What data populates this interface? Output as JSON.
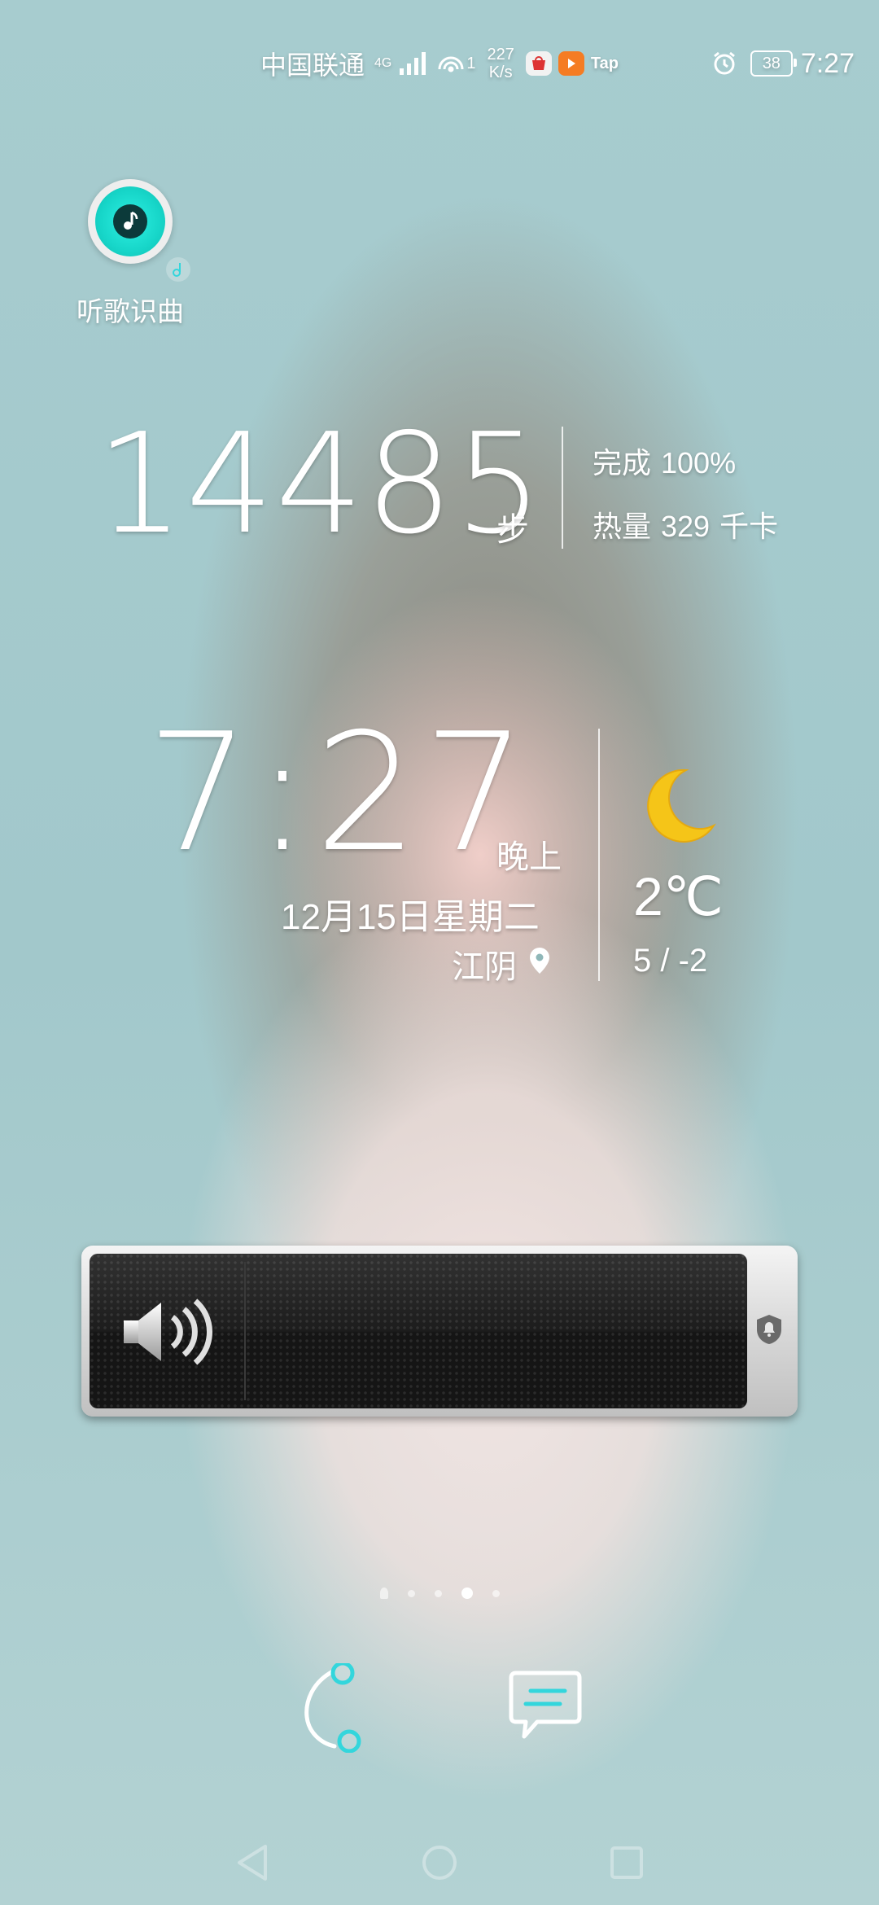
{
  "status_bar": {
    "carrier": "中国联通",
    "network_type": "4G",
    "hotspot_count": "1",
    "speed_value": "227",
    "speed_unit": "K/s",
    "app_label": "Tap",
    "battery": "38",
    "time": "7:27"
  },
  "music_app": {
    "label": "听歌识曲"
  },
  "steps_widget": {
    "count": "14485",
    "unit": "步",
    "completion_label": "完成",
    "completion_value": "100%",
    "calories_label": "热量",
    "calories_value": "329",
    "calories_unit": "千卡"
  },
  "clock_widget": {
    "time": "7:27",
    "period": "晚上",
    "date": "12月15日星期二",
    "location": "江阴"
  },
  "weather_widget": {
    "icon": "crescent-moon-icon",
    "temperature": "2℃",
    "range": "5 / -2"
  },
  "volume_panel": {
    "level": 0,
    "icon": "speaker-icon",
    "mode_icon": "bell-icon"
  },
  "pagination": {
    "pages": 5,
    "current": 4
  },
  "shortcuts": [
    {
      "name": "call-shortcut",
      "icon": "phone-handset-icon"
    },
    {
      "name": "messages-shortcut",
      "icon": "chat-bubble-icon"
    }
  ],
  "navigation": {
    "buttons": [
      "back",
      "home",
      "recents"
    ]
  },
  "colors": {
    "accent": "#33d6dc",
    "background": "#a9cdcf",
    "weather_moon": "#f5c518"
  }
}
